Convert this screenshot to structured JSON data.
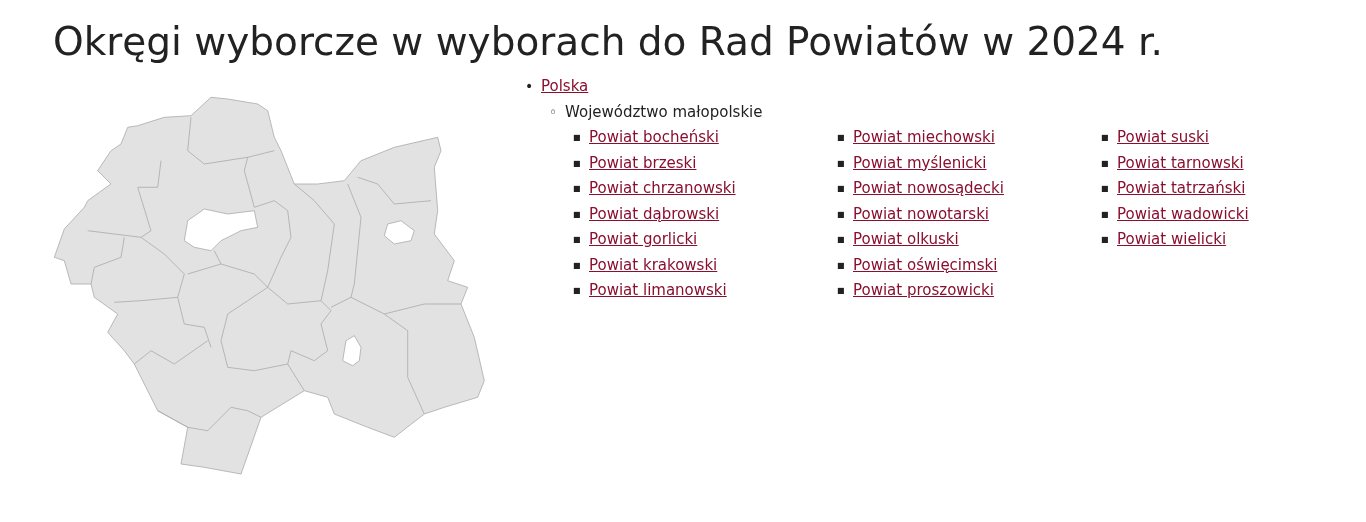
{
  "title": "Okręgi wyborcze w wyborach do Rad Powiatów w 2024 r.",
  "tree": [
    {
      "marker": "•",
      "label": "Polska",
      "kind": "link",
      "children": [
        {
          "marker": "◦",
          "label": "Województwo małopolskie",
          "kind": "text",
          "children": [
            {
              "marker": "■",
              "label": "Powiat bocheński",
              "kind": "link"
            },
            {
              "marker": "■",
              "label": "Powiat brzeski",
              "kind": "link"
            },
            {
              "marker": "■",
              "label": "Powiat chrzanowski",
              "kind": "link"
            },
            {
              "marker": "■",
              "label": "Powiat dąbrowski",
              "kind": "link"
            },
            {
              "marker": "■",
              "label": "Powiat gorlicki",
              "kind": "link"
            },
            {
              "marker": "■",
              "label": "Powiat krakowski",
              "kind": "link"
            },
            {
              "marker": "■",
              "label": "Powiat limanowski",
              "kind": "link"
            },
            {
              "marker": "■",
              "label": "Powiat miechowski",
              "kind": "link"
            },
            {
              "marker": "■",
              "label": "Powiat myślenicki",
              "kind": "link"
            },
            {
              "marker": "■",
              "label": "Powiat nowosądecki",
              "kind": "link"
            },
            {
              "marker": "■",
              "label": "Powiat nowotarski",
              "kind": "link"
            },
            {
              "marker": "■",
              "label": "Powiat olkuski",
              "kind": "link"
            },
            {
              "marker": "■",
              "label": "Powiat oświęcimski",
              "kind": "link"
            },
            {
              "marker": "■",
              "label": "Powiat proszowicki",
              "kind": "link"
            },
            {
              "marker": "■",
              "label": "Powiat suski",
              "kind": "link"
            },
            {
              "marker": "■",
              "label": "Powiat tarnowski",
              "kind": "link"
            },
            {
              "marker": "■",
              "label": "Powiat tatrzański",
              "kind": "link"
            },
            {
              "marker": "■",
              "label": "Powiat wadowicki",
              "kind": "link"
            },
            {
              "marker": "■",
              "label": "Powiat wielicki",
              "kind": "link"
            }
          ]
        }
      ]
    }
  ]
}
